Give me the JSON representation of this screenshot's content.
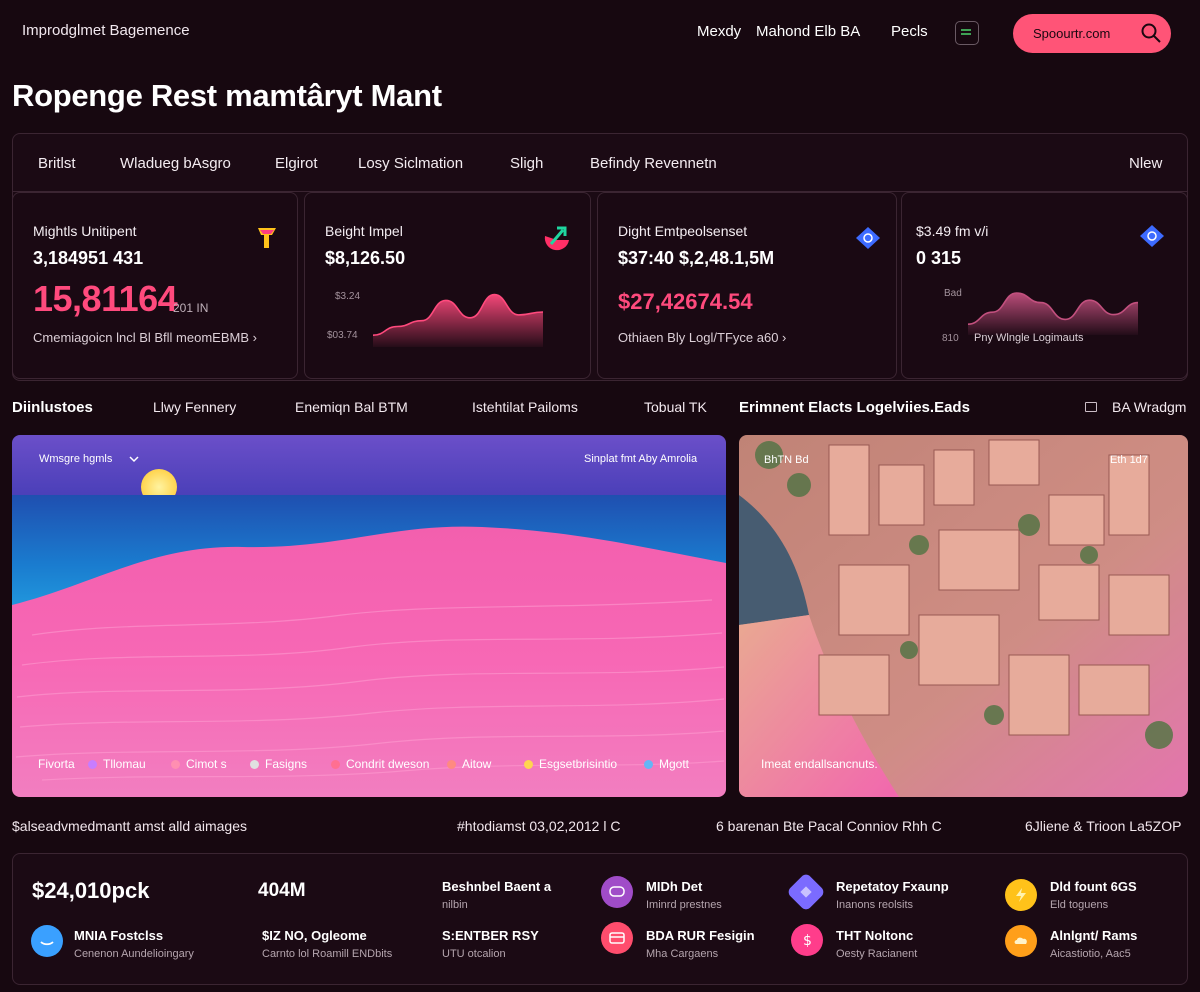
{
  "header": {
    "brand": "Improdglmet Bagemence",
    "nav": [
      "Mexdy",
      "Mahond Elb BA",
      "Pecls"
    ],
    "search_label": "Spoourtr.com"
  },
  "page_title": "Ropenge Rest mamtâryt Mant",
  "tabs": [
    "Britlst",
    "Wladueg bAsgro",
    "Elgirot",
    "Losy Siclmation",
    "Sligh",
    "Befindy Revennetn",
    "Nlew"
  ],
  "metrics": [
    {
      "title": "Mightls Unitipent",
      "value": "3,184951 431",
      "big": "15,81164",
      "suffix": "201 IN",
      "foot": "Cmemiagoicn lncl Bl Bfll meomEBMB ›",
      "icon": "flag-icon"
    },
    {
      "title": "Beight Impel",
      "value": "$8,126.50",
      "axis_top": "$3.24",
      "axis_bottom": "$03.74",
      "icon": "chart-arrow-icon",
      "spark": [
        0.1,
        0.25,
        0.35,
        0.7,
        0.4,
        0.8,
        0.45,
        0.5
      ]
    },
    {
      "title": "Dight Emtpeolsenset",
      "value": "$37:40 $,2,48.1,5M",
      "big": "$27,42674.54",
      "foot": "Othiaen Bly Logl/TFyce a60 ›",
      "icon": "tag-icon"
    },
    {
      "title": "$3.49 fm v/i",
      "value": "0 315",
      "axis_top": "Bad",
      "axis_bottom": "810",
      "foot": "Pny Wlngle Logimauts",
      "icon": "tag-icon",
      "spark": [
        0.1,
        0.35,
        0.75,
        0.55,
        0.2,
        0.6,
        0.3,
        0.55
      ]
    }
  ],
  "section_tabs": [
    "Diinlustoes",
    "Llwy Fennery",
    "Enemiqn Bal BTM",
    "Istehtilat Pailoms",
    "Tobual TK",
    "Erimnent Elacts Logelviies.Eads"
  ],
  "section_right_label": "BA Wradgm",
  "ocean_image": {
    "top_left": "Wmsgre hgmls",
    "top_right": "Sinplat fmt Aby Amrolia",
    "legend": [
      {
        "label": "Fivorta",
        "color": ""
      },
      {
        "label": "Tllomau",
        "color": "#c77dff"
      },
      {
        "label": "Cimot s",
        "color": "#ff8fb1"
      },
      {
        "label": "Fasigns",
        "color": "#e0e0e0"
      },
      {
        "label": "Condrit dweson",
        "color": "#ff6f91"
      },
      {
        "label": "Aitow",
        "color": "#ff8a80"
      },
      {
        "label": "Esgsetbrisintio",
        "color": "#ffd54f"
      },
      {
        "label": "Mgott",
        "color": "#64b5f6"
      }
    ]
  },
  "city_image": {
    "top_left": "BhTN Bd",
    "top_right": "Eth 1d7",
    "caption": "Imeat endallsancnuts."
  },
  "bottom_heads": [
    "$alseadvmedmantt amst alld aimages",
    "#htodiamst 03,02,2012 l C",
    "6 barenan Bte Pacal Conniov Rhh C",
    "6Jliene & Trioon La5ZOP"
  ],
  "stats": [
    {
      "value": "$24,010pck"
    },
    {
      "value": "404M"
    },
    {
      "title": "MNIA Fostclss",
      "sub": "Cenenon Aundelioingary",
      "icon": "circle-check-icon",
      "color": "#3aa0ff"
    },
    {
      "title": "$IZ NO, Ogleome",
      "sub": "Carnto lol Roamill ENDbits"
    },
    {
      "title": "Beshnbel Baent a",
      "sub": "nilbin"
    },
    {
      "title": "S:ENTBER RSY",
      "sub": "UTU otcalion"
    },
    {
      "title": "MIDh Det",
      "sub": "Iminrd prestnes",
      "icon": "message-icon",
      "color": "#a04cc8"
    },
    {
      "title": "BDA RUR Fesigin",
      "sub": "Mha Cargaens",
      "icon": "card-icon",
      "color": "#ff4d6d"
    },
    {
      "title": "Repetatoy Fxaunp",
      "sub": "Inanons reolsits",
      "icon": "diamond-icon",
      "color": "#7b6bff"
    },
    {
      "title": "THT Noltonc",
      "sub": "Oesty Racianent",
      "icon": "dollar-icon",
      "color": "#ff3d8b"
    },
    {
      "title": "Dld fount 6GS",
      "sub": "Eld toguens",
      "icon": "bolt-icon",
      "color": "#ffc21a"
    },
    {
      "title": "Alnlgnt/ Rams",
      "sub": "Aicastiotio, Aac5",
      "icon": "cloud-icon",
      "color": "#ff9f1a"
    }
  ]
}
